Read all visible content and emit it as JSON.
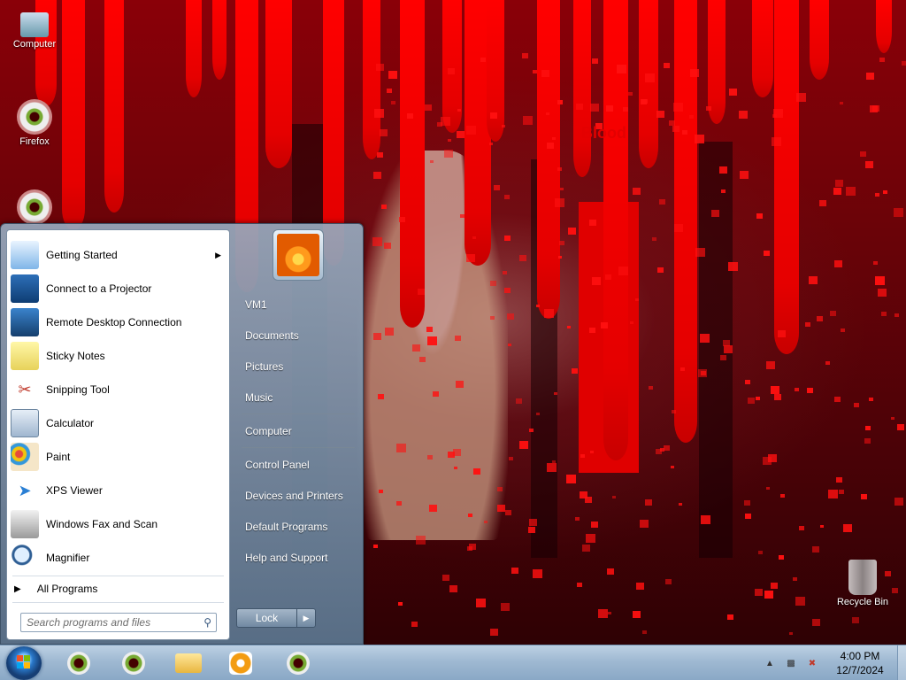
{
  "desktop": {
    "icons": [
      {
        "label": "Computer",
        "icon": "computer-icon"
      },
      {
        "label": "Firefox",
        "icon": "firefox-eye-icon"
      },
      {
        "label": "",
        "icon": "eye-icon"
      },
      {
        "label": "Recycle Bin",
        "icon": "recycle-bin-icon"
      }
    ],
    "wallpaper_text": "Blood"
  },
  "start_menu": {
    "programs": [
      {
        "label": "Getting Started",
        "icon": "getting-started-icon",
        "has_submenu": true
      },
      {
        "label": "Connect to a Projector",
        "icon": "projector-icon"
      },
      {
        "label": "Remote Desktop Connection",
        "icon": "remote-desktop-icon"
      },
      {
        "label": "Sticky Notes",
        "icon": "sticky-notes-icon"
      },
      {
        "label": "Snipping Tool",
        "icon": "snipping-tool-icon"
      },
      {
        "label": "Calculator",
        "icon": "calculator-icon"
      },
      {
        "label": "Paint",
        "icon": "paint-icon"
      },
      {
        "label": "XPS Viewer",
        "icon": "xps-viewer-icon"
      },
      {
        "label": "Windows Fax and Scan",
        "icon": "fax-scan-icon"
      },
      {
        "label": "Magnifier",
        "icon": "magnifier-icon"
      }
    ],
    "all_programs": "All Programs",
    "search_placeholder": "Search programs and files",
    "user_name": "VM1",
    "right_links": [
      {
        "label": "Documents"
      },
      {
        "label": "Pictures"
      },
      {
        "label": "Music"
      },
      {
        "label": "Computer"
      },
      {
        "label": "Control Panel"
      },
      {
        "label": "Devices and Printers"
      },
      {
        "label": "Default Programs"
      },
      {
        "label": "Help and Support"
      }
    ],
    "lock_label": "Lock"
  },
  "taskbar": {
    "pinned": [
      {
        "icon": "eye-icon"
      },
      {
        "icon": "eye-icon"
      },
      {
        "icon": "windows-explorer-icon"
      },
      {
        "icon": "media-player-icon"
      },
      {
        "icon": "eye-icon"
      }
    ],
    "clock": {
      "time": "4:00 PM",
      "date": "12/7/2024"
    }
  },
  "colors": {
    "accent": "#ff0000",
    "taskbar": "#9fb9d2",
    "menu_frame": "#7189a2"
  }
}
